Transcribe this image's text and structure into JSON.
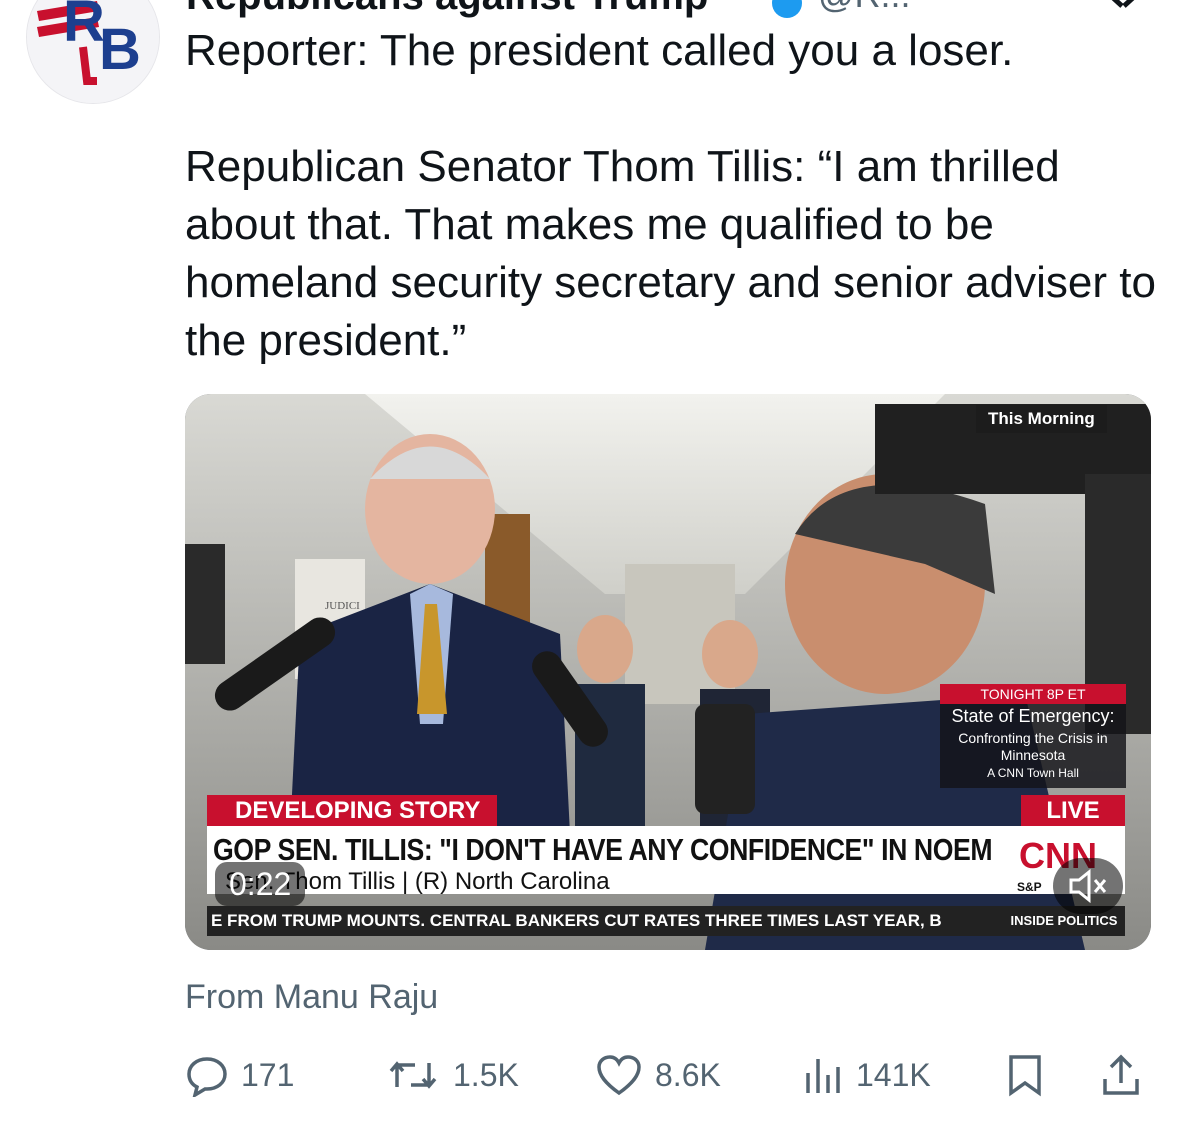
{
  "header": {
    "name": "Republicans against Trump",
    "handle": "@R...",
    "avatar_text": "RB"
  },
  "tweet": {
    "lines": [
      "Reporter: The president called you a loser.",
      "Republican Senator Thom Tillis: “I am thrilled about that. That makes me qualified to be homeland security secretary and senior adviser to the president.”"
    ]
  },
  "media": {
    "top_label": "This Morning",
    "promo": {
      "top": "TONIGHT 8P ET",
      "title": "State of Emergency:",
      "subtitle": "Confronting the Crisis in Minnesota",
      "foot": "A CNN Town Hall"
    },
    "developing": "DEVELOPING STORY",
    "live": "LIVE",
    "headline": "GOP SEN. TILLIS: \"I DON'T HAVE ANY CONFIDENCE\" IN NOEM",
    "subline": "Sen. Thom Tillis  |  (R) North Carolina",
    "network": "CNN",
    "sp_label": "S&P",
    "ticker": "E FROM TRUMP MOUNTS. CENTRAL BANKERS CUT RATES THREE TIMES LAST YEAR, B",
    "ticker_brand": "INSIDE POLITICS",
    "duration": "0:22",
    "judiciary_sign": "JUDICI"
  },
  "source": "From Manu Raju",
  "actions": {
    "replies": "171",
    "reposts": "1.5K",
    "likes": "8.6K",
    "views": "141K"
  },
  "colors": {
    "text": "#0f1419",
    "secondary": "#536471",
    "cnn_red": "#c8102e",
    "verified": "#1d9bf0"
  }
}
